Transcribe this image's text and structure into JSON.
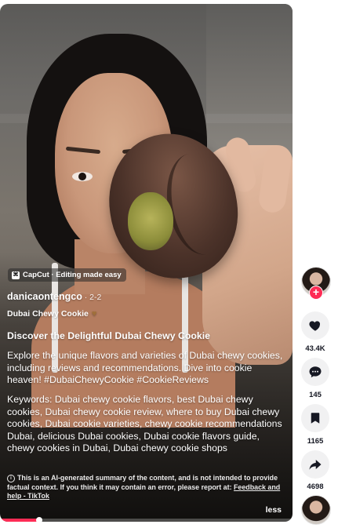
{
  "overlay": {
    "capcut_label": "CapCut · Editing made easy",
    "author": "danicaontengco",
    "date": " · 2-2",
    "sound_label": "Dubai Chewy Cookie",
    "headline": "Discover the Delightful Dubai Chewy Cookie",
    "description": "Explore the unique flavors and varieties of Dubai chewy cookies, including reviews and recommendations. Dive into cookie heaven! #DubaiChewyCookie #CookieReviews",
    "keywords": "Keywords: Dubai chewy cookie flavors, best Dubai chewy cookies, Dubai chewy cookie review, where to buy Dubai chewy cookies, Dubai cookie varieties, chewy cookie recommendations Dubai, delicious Dubai cookies, Dubai cookie flavors guide, chewy cookies in Dubai, Dubai chewy cookie shops",
    "ai_notice": "This is an AI-generated summary of the content, and is not intended to provide factual context. If you think it may contain an error, please report at: ",
    "ai_notice_link": "Feedback and help - TikTok",
    "less_label": "less",
    "progress_fraction": 0.135
  },
  "rail": {
    "like_count": "43.4K",
    "comment_count": "145",
    "save_count": "1165",
    "share_count": "4698",
    "follow_symbol": "+"
  },
  "colors": {
    "accent": "#fe2c55",
    "rail_button_bg": "#f1f1f2",
    "count_text": "#161823"
  },
  "icons": [
    "capcut-icon",
    "heart-emoji-icon",
    "info-icon",
    "heart-icon",
    "comment-icon",
    "bookmark-icon",
    "share-icon",
    "plus-icon"
  ]
}
